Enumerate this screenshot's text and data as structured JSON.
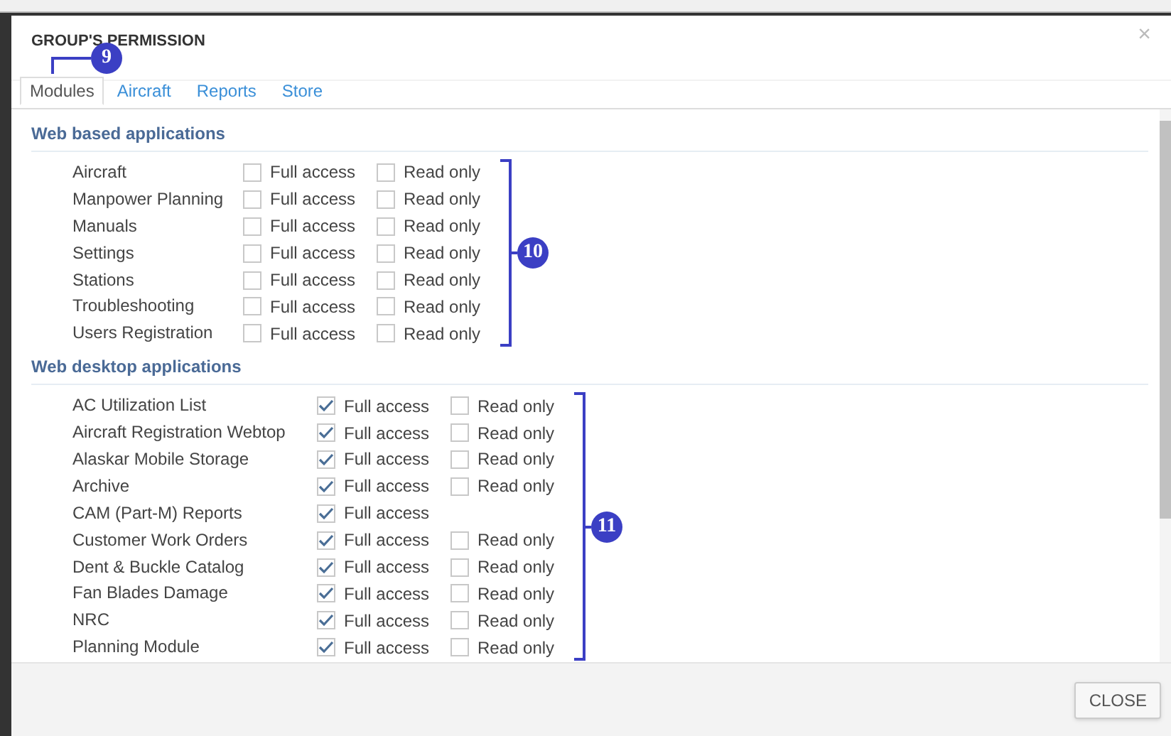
{
  "dialog": {
    "title": "GROUP'S PERMISSION",
    "close_symbol": "×"
  },
  "tabs": [
    {
      "label": "Modules",
      "selected": true,
      "callout": "9"
    },
    {
      "label": "Aircraft",
      "selected": false
    },
    {
      "label": "Reports",
      "selected": false
    },
    {
      "label": "Store",
      "selected": false
    }
  ],
  "sections": [
    {
      "title": "Web based applications",
      "callout": "10",
      "rows": [
        {
          "name": "Aircraft",
          "permissions": [
            {
              "label": "Full access",
              "checked": false
            },
            {
              "label": "Read only",
              "checked": false
            }
          ]
        },
        {
          "name": "Manpower Planning",
          "permissions": [
            {
              "label": "Full access",
              "checked": false
            },
            {
              "label": "Read only",
              "checked": false
            }
          ]
        },
        {
          "name": "Manuals",
          "permissions": [
            {
              "label": "Full access",
              "checked": false
            },
            {
              "label": "Read only",
              "checked": false
            }
          ]
        },
        {
          "name": "Settings",
          "permissions": [
            {
              "label": "Full access",
              "checked": false
            },
            {
              "label": "Read only",
              "checked": false
            }
          ]
        },
        {
          "name": "Stations",
          "permissions": [
            {
              "label": "Full access",
              "checked": false
            },
            {
              "label": "Read only",
              "checked": false
            }
          ]
        },
        {
          "name": "Troubleshooting",
          "permissions": [
            {
              "label": "Full access",
              "checked": false
            },
            {
              "label": "Read only",
              "checked": false
            }
          ]
        },
        {
          "name": "Users Registration",
          "permissions": [
            {
              "label": "Full access",
              "checked": false
            },
            {
              "label": "Read only",
              "checked": false
            }
          ]
        }
      ]
    },
    {
      "title": "Web desktop applications",
      "callout": "11",
      "rows": [
        {
          "name": "AC Utilization List",
          "permissions": [
            {
              "label": "Full access",
              "checked": true
            },
            {
              "label": "Read only",
              "checked": false
            }
          ]
        },
        {
          "name": "Aircraft Registration Webtop",
          "permissions": [
            {
              "label": "Full access",
              "checked": true
            },
            {
              "label": "Read only",
              "checked": false
            }
          ]
        },
        {
          "name": "Alaskar Mobile Storage",
          "permissions": [
            {
              "label": "Full access",
              "checked": true
            },
            {
              "label": "Read only",
              "checked": false
            }
          ]
        },
        {
          "name": "Archive",
          "permissions": [
            {
              "label": "Full access",
              "checked": true
            },
            {
              "label": "Read only",
              "checked": false
            }
          ]
        },
        {
          "name": "CAM (Part-M) Reports",
          "permissions": [
            {
              "label": "Full access",
              "checked": true
            }
          ]
        },
        {
          "name": "Customer Work Orders",
          "permissions": [
            {
              "label": "Full access",
              "checked": true
            },
            {
              "label": "Read only",
              "checked": false
            }
          ]
        },
        {
          "name": "Dent & Buckle Catalog",
          "permissions": [
            {
              "label": "Full access",
              "checked": true
            },
            {
              "label": "Read only",
              "checked": false
            }
          ]
        },
        {
          "name": "Fan Blades Damage",
          "permissions": [
            {
              "label": "Full access",
              "checked": true
            },
            {
              "label": "Read only",
              "checked": false
            }
          ]
        },
        {
          "name": "NRC",
          "permissions": [
            {
              "label": "Full access",
              "checked": true
            },
            {
              "label": "Read only",
              "checked": false
            }
          ]
        },
        {
          "name": "Planning Module",
          "permissions": [
            {
              "label": "Full access",
              "checked": true
            },
            {
              "label": "Read only",
              "checked": false
            }
          ]
        }
      ]
    }
  ],
  "footer": {
    "buttons": [
      "CLOSE"
    ]
  }
}
